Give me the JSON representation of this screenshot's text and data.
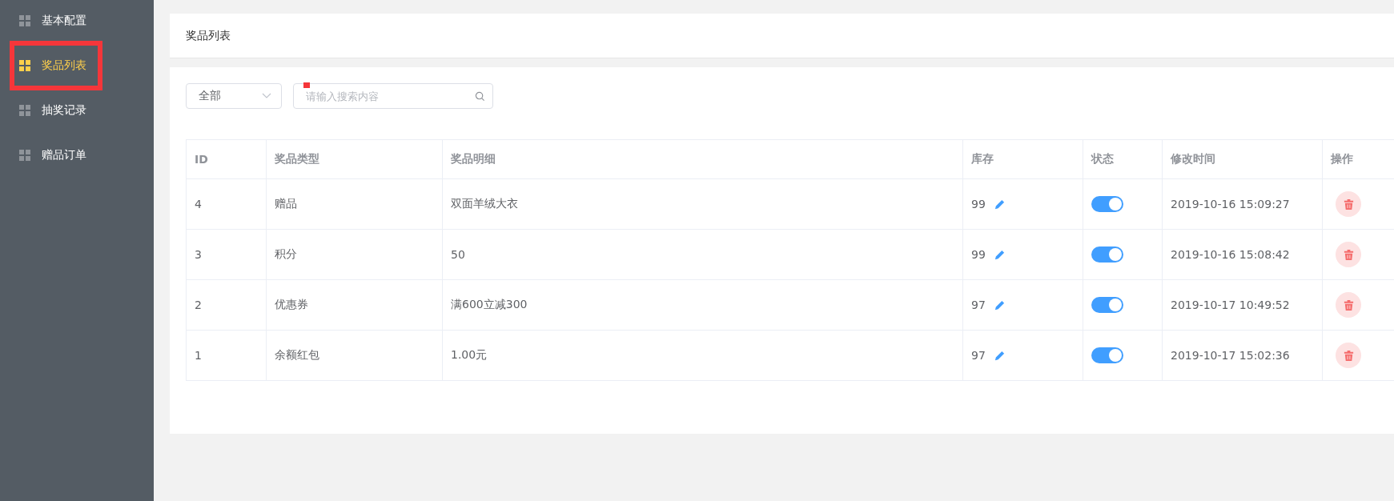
{
  "sidebar": {
    "items": [
      {
        "label": "基本配置",
        "selected": false
      },
      {
        "label": "奖品列表",
        "selected": true
      },
      {
        "label": "抽奖记录",
        "selected": false
      },
      {
        "label": "赠品订单",
        "selected": false
      }
    ]
  },
  "header": {
    "title": "奖品列表"
  },
  "filter": {
    "select_value": "全部",
    "search_placeholder": "请输入搜索内容"
  },
  "table": {
    "columns": [
      "ID",
      "奖品类型",
      "奖品明细",
      "库存",
      "状态",
      "修改时间",
      "操作"
    ],
    "rows": [
      {
        "id": "4",
        "type": "赠品",
        "detail": "双面羊绒大衣",
        "stock": "99",
        "on": true,
        "time": "2019-10-16 15:09:27"
      },
      {
        "id": "3",
        "type": "积分",
        "detail": "50",
        "stock": "99",
        "on": true,
        "time": "2019-10-16 15:08:42"
      },
      {
        "id": "2",
        "type": "优惠券",
        "detail": "满600立减300",
        "stock": "97",
        "on": true,
        "time": "2019-10-17 10:49:52"
      },
      {
        "id": "1",
        "type": "余额红包",
        "detail": "1.00元",
        "stock": "97",
        "on": true,
        "time": "2019-10-17 15:02:36"
      }
    ]
  }
}
